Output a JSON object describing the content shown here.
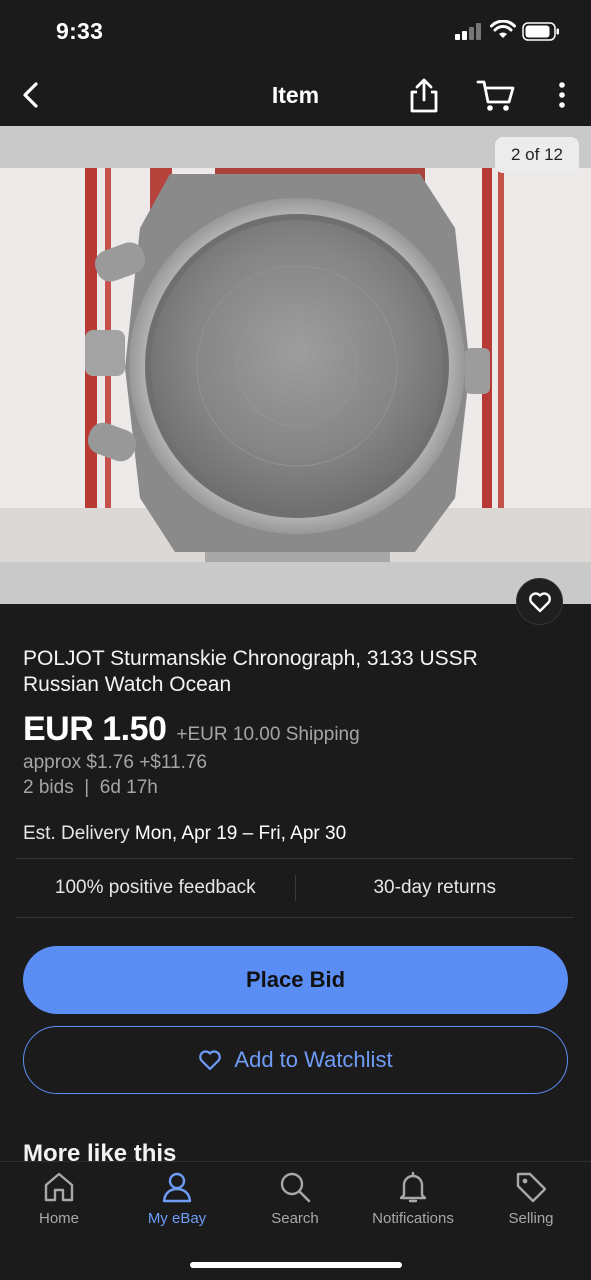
{
  "status_bar": {
    "time": "9:33"
  },
  "nav": {
    "title": "Item"
  },
  "gallery": {
    "counter": "2 of 12"
  },
  "item": {
    "title": "POLJOT Sturmanskie Chronograph, 3133 USSR Russian Watch Ocean",
    "price": "EUR 1.50",
    "shipping": "+EUR 10.00 Shipping",
    "approx": "approx $1.76 +$11.76",
    "bids": "2 bids",
    "time_left": "6d 17h",
    "delivery_label": "Est. Delivery",
    "delivery_dates": "Mon, Apr 19 – Fri, Apr 30"
  },
  "features": {
    "feedback": "100% positive feedback",
    "returns": "30-day returns"
  },
  "actions": {
    "place_bid": "Place Bid",
    "watchlist": "Add to Watchlist"
  },
  "section": {
    "more_like": "More like this"
  },
  "tabs": [
    {
      "label": "Home",
      "icon": "home-icon"
    },
    {
      "label": "My eBay",
      "icon": "person-icon",
      "active": true
    },
    {
      "label": "Search",
      "icon": "search-icon"
    },
    {
      "label": "Notifications",
      "icon": "bell-icon"
    },
    {
      "label": "Selling",
      "icon": "tag-icon"
    }
  ],
  "colors": {
    "accent": "#5b8ef5",
    "background": "#1b1b1b"
  }
}
